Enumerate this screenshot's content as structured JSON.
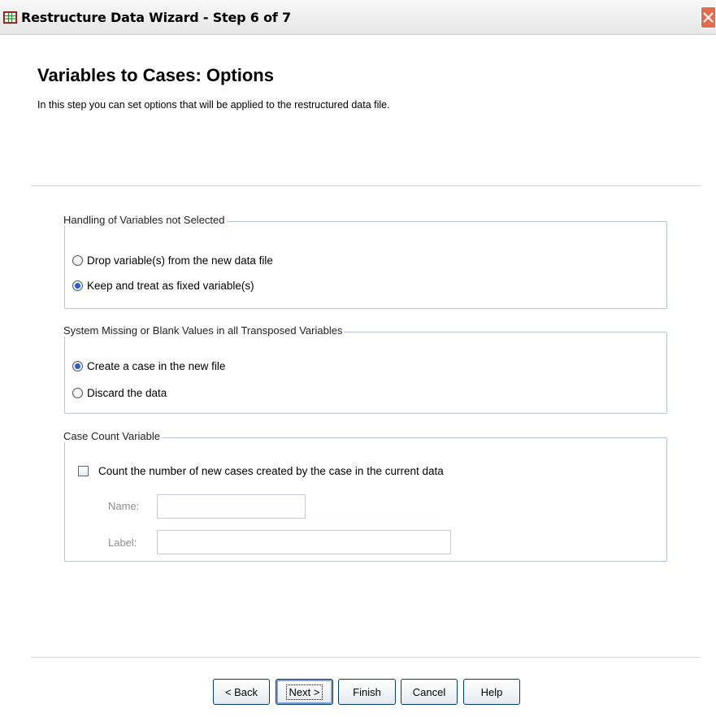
{
  "window": {
    "title": "Restructure Data Wizard - Step 6 of 7"
  },
  "icons": {
    "app": "grid-table-icon",
    "close": "close-icon"
  },
  "header": {
    "title": "Variables to Cases: Options",
    "description": "In this step you can set options that will be applied to the restructured data file."
  },
  "groups": {
    "handling": {
      "legend": "Handling of Variables not Selected",
      "options": [
        {
          "label": "Drop variable(s) from the new data file",
          "selected": false
        },
        {
          "label": "Keep and treat as fixed variable(s)",
          "selected": true
        }
      ]
    },
    "missing": {
      "legend": "System Missing or Blank Values in all Transposed Variables",
      "options": [
        {
          "label": "Create a case in the new file",
          "selected": true
        },
        {
          "label": "Discard the data",
          "selected": false
        }
      ]
    },
    "case_count": {
      "legend": "Case Count Variable",
      "checkbox_label": "Count the number of new cases created by the case in the current data",
      "checked": false,
      "name_label": "Name:",
      "name_value": "",
      "label_label": "Label:",
      "label_value": ""
    }
  },
  "buttons": {
    "back": "< Back",
    "next": "Next >",
    "finish": "Finish",
    "cancel": "Cancel",
    "help": "Help"
  },
  "colors": {
    "group_border": "#b6c3d3",
    "radio_selected": "#2a5fd0",
    "close_button": "#e46a4e"
  }
}
